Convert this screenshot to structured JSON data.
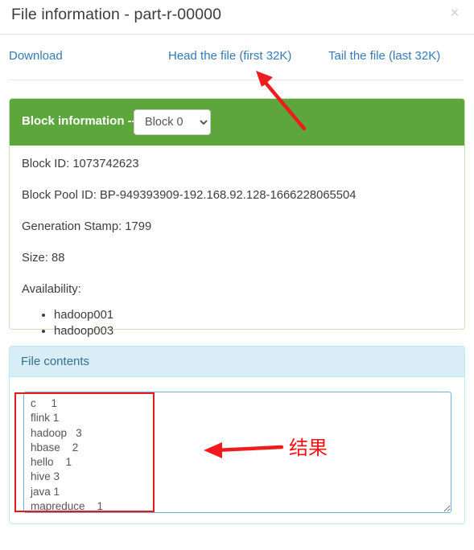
{
  "modal": {
    "title": "File information - part-r-00000",
    "close_icon": "close-icon",
    "close_label": "×"
  },
  "actions": {
    "download": "Download",
    "head": "Head the file (first 32K)",
    "tail": "Tail the file (last 32K)"
  },
  "block_panel": {
    "heading_label": "Block information --",
    "accent_color": "#5ca63c",
    "selected_block": "Block 0",
    "block_options": [
      "Block 0"
    ],
    "chevron_icon": "chevron-down-icon",
    "fields": {
      "block_id": "Block ID: 1073742623",
      "block_pool_id": "Block Pool ID: BP-949393909-192.168.92.128-1666228065504",
      "generation_stamp": "Generation Stamp: 1799",
      "size": "Size: 88",
      "availability_label": "Availability:"
    },
    "availability": [
      "hadoop001",
      "hadoop003"
    ]
  },
  "file_panel": {
    "heading_label": "File contents",
    "accent_color": "#d9edf7",
    "heading_text_color": "#31708f",
    "contents": "c     1\nflink 1\nhadoop   3\nhbase    2\nhello    1\nhive 3\njava 1\nmapreduce    1",
    "scrollbar": {
      "up_icon": "scroll-up-arrow-icon",
      "down_icon": "scroll-down-arrow-icon",
      "resize_icon": "resize-grip-icon"
    }
  },
  "annotations": {
    "arrow_top_icon": "red-arrow-up-left-icon",
    "arrow_bottom_icon": "red-arrow-left-icon",
    "result_label": "结果",
    "highlight_box": "red-highlight-box",
    "color": "#ee1c1c"
  }
}
